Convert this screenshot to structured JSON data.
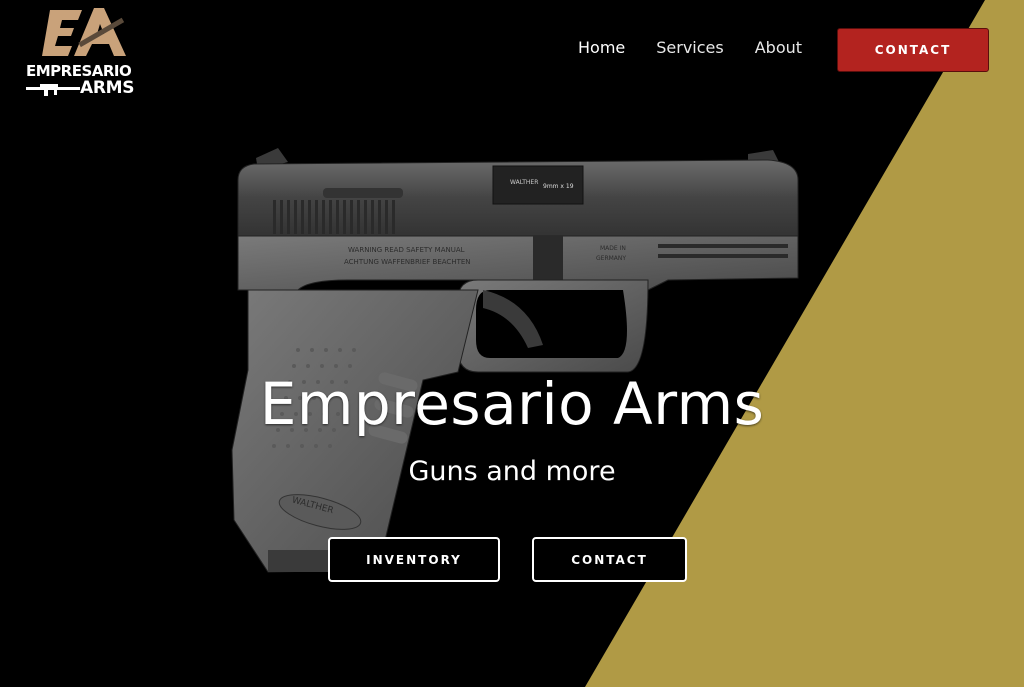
{
  "brand": {
    "monogram": "EA",
    "name_line1": "EMPRESARIO",
    "name_line2": "ARMS",
    "colors": {
      "tan": "#c9a27a",
      "white": "#ffffff"
    }
  },
  "nav": {
    "items": [
      {
        "label": "Home",
        "active": true
      },
      {
        "label": "Services",
        "active": false
      },
      {
        "label": "About",
        "active": false
      }
    ],
    "contact_label": "CONTACT"
  },
  "hero": {
    "title": "Empresario Arms",
    "subtitle": "Guns and more",
    "buttons": {
      "inventory": "INVENTORY",
      "contact": "CONTACT"
    },
    "image_text": {
      "slide_brand": "WALTHER",
      "caliber": "9mm x 19",
      "warning_line1": "WARNING READ SAFETY MANUAL",
      "warning_line2": "ACHTUNG WAFFENBRIEF BEACHTEN",
      "origin_line1": "MADE IN",
      "origin_line2": "GERMANY",
      "grip_brand": "WALTHER"
    }
  },
  "colors": {
    "background": "#000000",
    "gold": "#b09a45",
    "accent_red": "#b3231f"
  }
}
